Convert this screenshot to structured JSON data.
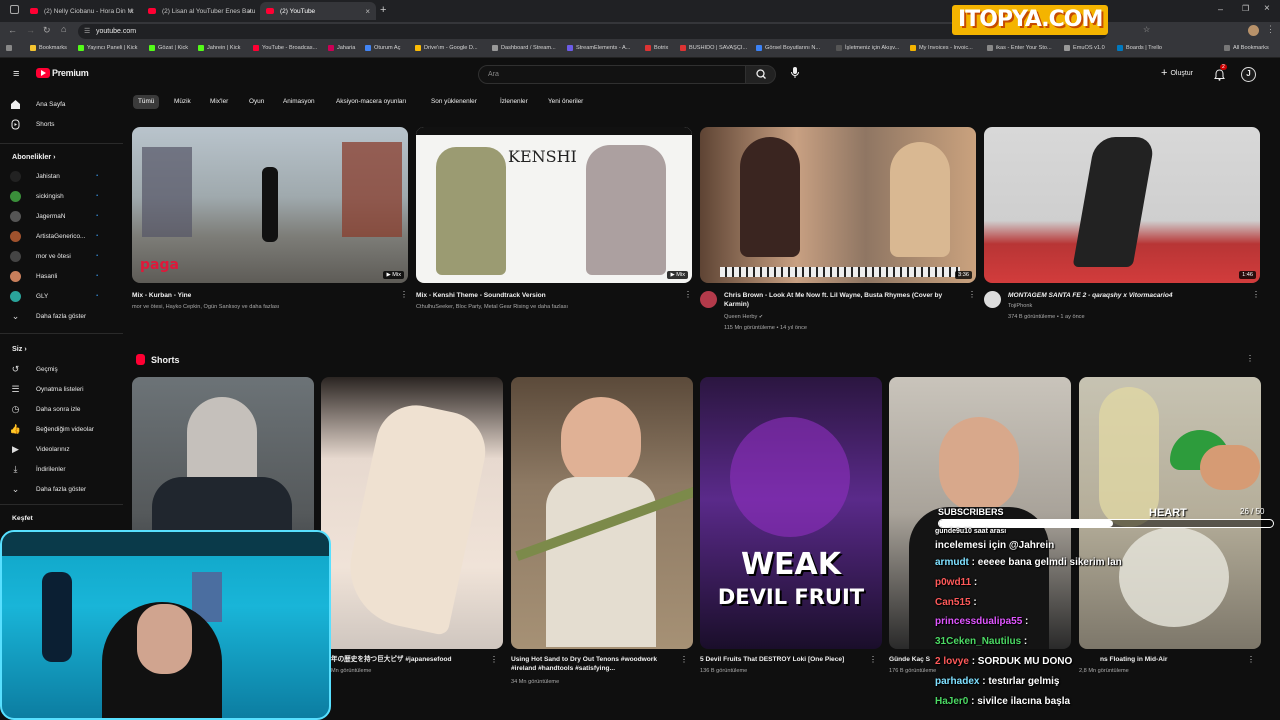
{
  "browser": {
    "tabs": [
      {
        "title": "(2) Nelly Ciobanu - Hora Din M"
      },
      {
        "title": "(2) Lisan al YouTuber Enes Batu"
      },
      {
        "title": "(2) YouTube"
      }
    ],
    "url": "youtube.com",
    "bookmarks": [
      "Bookmarks",
      "Yayıncı Paneli | Kick",
      "Gözat | Kick",
      "Jahrein | Kick",
      "YouTube - Broadcas...",
      "Jaharia",
      "Oturum Aç",
      "Drive'ım - Google D...",
      "Dashboard / Stream...",
      "StreamElements - A...",
      "Botrix",
      "BUSHIDO | SAVAŞÇI...",
      "Görsel Boyutlarını N...",
      "İşletmeniz için Akışv...",
      "My Invoices - Invoic...",
      "ikas - Enter Your Sto...",
      "EmuOS v1.0",
      "Boards | Trello",
      "All Bookmarks"
    ]
  },
  "overlay": {
    "logo_text": "ITOPYA.COM",
    "subscribers_label": "SUBSCRIBERS",
    "heart_label": "HEART",
    "goal": "26 / 50",
    "chat": [
      {
        "user": "gunde9u10 saat arası",
        "msg": "",
        "color": "#ffffff"
      },
      {
        "user": "",
        "msg": "incelemesi için @Jahrein",
        "color": "#ffffff"
      },
      {
        "user": "armudt",
        "msg": ": eeeee bana gelmdi sikerim lan",
        "color": "#7fe0ff"
      },
      {
        "user": "p0wd11",
        "msg": ":",
        "color": "#ff5a5a"
      },
      {
        "user": "Can515",
        "msg": ":",
        "color": "#ff5a5a"
      },
      {
        "user": "princessdualipa55",
        "msg": ":",
        "color": "#e056ff"
      },
      {
        "user": "31Ceken_Nautilus",
        "msg": ":",
        "color": "#4cd964"
      },
      {
        "user": "2 lovye",
        "msg": ": SORDUK MU DONO",
        "color": "#ff5a5a"
      },
      {
        "user": "parhadex",
        "msg": ": testırlar gelmiş",
        "color": "#7fe0ff"
      },
      {
        "user": "HaJer0",
        "msg": ": sivilce ilacına başla",
        "color": "#4cd964"
      }
    ]
  },
  "header": {
    "logo": "Premium",
    "search_placeholder": "Ara",
    "create_label": "Oluştur",
    "notif_count": "2"
  },
  "sidebar": {
    "main": [
      {
        "label": "Ana Sayfa",
        "icon": "home-icon"
      },
      {
        "label": "Shorts",
        "icon": "shorts-icon"
      }
    ],
    "subs_title": "Abonelikler",
    "subs": [
      {
        "label": "Jahistan",
        "color": "#222"
      },
      {
        "label": "sickingish",
        "color": "#3a8f3a"
      },
      {
        "label": "JagermaN",
        "color": "#555"
      },
      {
        "label": "ArtistaGenerico...",
        "color": "#a0522d"
      },
      {
        "label": "mor ve ötesi",
        "color": "#444"
      },
      {
        "label": "Hasanli",
        "color": "#c97f5b"
      },
      {
        "label": "GLY",
        "color": "#2aa39a"
      },
      {
        "label": "Daha fazla göster",
        "color": ""
      }
    ],
    "you_title": "Siz",
    "you": [
      {
        "label": "Geçmiş",
        "icon": "history-icon"
      },
      {
        "label": "Oynatma listeleri",
        "icon": "playlist-icon"
      },
      {
        "label": "Daha sonra izle",
        "icon": "clock-icon"
      },
      {
        "label": "Beğendiğim videolar",
        "icon": "like-icon"
      },
      {
        "label": "Videolarınız",
        "icon": "video-icon"
      },
      {
        "label": "İndirilenler",
        "icon": "download-icon"
      },
      {
        "label": "Daha fazla göster",
        "icon": "chevron-down-icon"
      }
    ],
    "explore_title": "Keşfet"
  },
  "chips": [
    "Tümü",
    "Müzik",
    "Mix'ler",
    "Oyun",
    "Animasyon",
    "Aksiyon-macera oyunları",
    "Son yüklenenler",
    "İzlenenler",
    "Yeni öneriler"
  ],
  "videos": [
    {
      "title": "Mix - Kurban - Yine",
      "meta1": "mor ve ötesi, Hayko Cepkin, Ogün Sanlısoy ve daha fazlası",
      "meta2": "",
      "badge": "Mix",
      "thumb_text": "paga"
    },
    {
      "title": "Mix - Kenshi Theme - Soundtrack Version",
      "meta1": "CthulhuSeeker, Bloc Party, Metal Gear Rising ve daha fazlası",
      "meta2": "",
      "badge": "Mix",
      "thumb_text": "KENSHI"
    },
    {
      "title": "Chris Brown - Look At Me Now ft. Lil Wayne, Busta Rhymes (Cover by Karmin)",
      "meta1": "Queen Herby",
      "meta2": "115 Mn görüntüleme • 14 yıl önce",
      "badge": "3:36",
      "thumb_text": ""
    },
    {
      "title": "MONTAGEM SANTA FE 2 - qaraqshy x Vitormacario4",
      "meta1": "TojiPhonk",
      "meta2": "374 B görüntüleme • 1 ay önce",
      "badge": "1:46",
      "thumb_text": ""
    }
  ],
  "shorts_title": "Shorts",
  "shorts": [
    {
      "title": "",
      "views": ""
    },
    {
      "title": "年の歴史を持つ巨大ピザ #japanesefood",
      "views": "Mn görüntüleme"
    },
    {
      "title": "Using Hot Sand to Dry Out Tenons #woodwork #ireland #handtools #satisfying...",
      "views": "34 Mn görüntüleme"
    },
    {
      "title": "5 Devil Fruits That DESTROY Loki [One Piece]",
      "views": "136 B görüntüleme",
      "thumb_text1": "WEAK",
      "thumb_text2": "DEVIL FRUIT"
    },
    {
      "title": "Günde Kaç S",
      "views": "176 B görüntüleme"
    },
    {
      "title": "ns Floating in Mid-Air",
      "views": "2,8 Mn görüntüleme"
    }
  ]
}
